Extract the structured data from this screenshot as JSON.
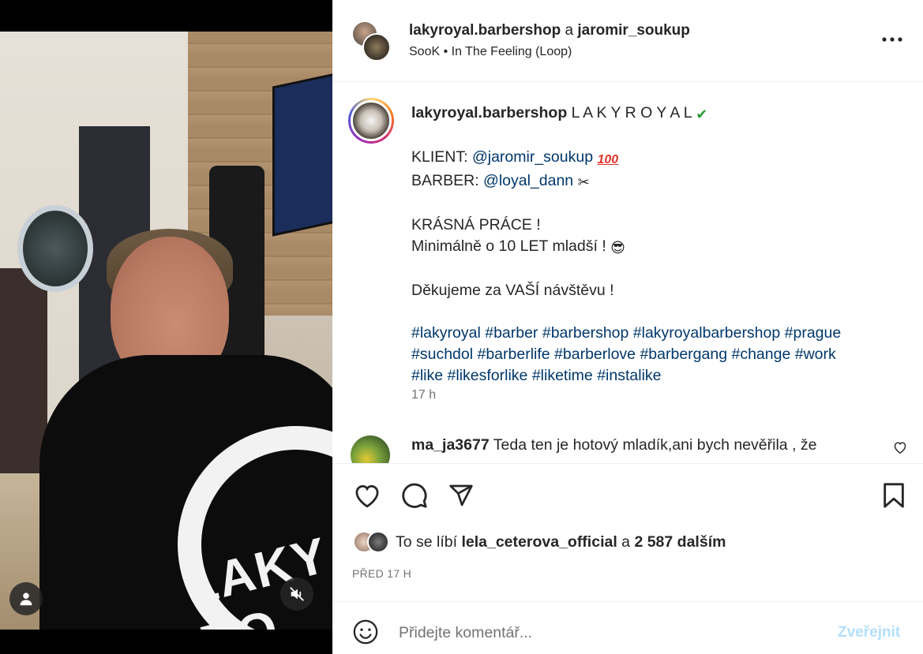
{
  "header": {
    "user1": "lakyroyal.barbershop",
    "connector": "a",
    "user2": "jaromir_soukup",
    "audio_artist": "SooK",
    "audio_separator": "•",
    "audio_track": "In The Feeling (Loop)"
  },
  "caption": {
    "username": "lakyroyal.barbershop",
    "brand": "L A K Y R O Y A L",
    "check_emoji": "✔",
    "client_label": "KLIENT:",
    "client_mention": "@jaromir_soukup",
    "hundred_emoji": "100",
    "barber_label": "BARBER:",
    "barber_mention": "@loyal_dann",
    "scissors_emoji": "✂",
    "line1": "KRÁSNÁ PRÁCE !",
    "line2": "Minimálně o 10 LET mladší !",
    "sunglasses_emoji": "😎",
    "line3": "Děkujeme za VAŠÍ návštěvu !",
    "hashtags": [
      "#lakyroyal",
      "#barber",
      "#barbershop",
      "#lakyroyalbarbershop",
      "#prague",
      "#suchdol",
      "#barberlife",
      "#barberlove",
      "#barbergang",
      "#change",
      "#work",
      "#like",
      "#likesforlike",
      "#liketime",
      "#instalike"
    ],
    "time": "17 h"
  },
  "comment": {
    "username": "ma_ja3677",
    "text": "Teda ten je hotový mladík,ani bych nevěřila , že"
  },
  "likes": {
    "prefix": "To se líbí",
    "user": "lela_ceterova_official",
    "connector": "a",
    "count": "2 587 dalším"
  },
  "post_date": "PŘED 17 H",
  "add_comment": {
    "placeholder": "Přidejte komentář...",
    "publish": "Zveřejnit"
  },
  "media": {
    "logo_text": "LAKY RO"
  },
  "colors": {
    "text": "#262626",
    "secondary": "#737373",
    "link": "#00376b",
    "publish_disabled": "#b2dffc"
  }
}
